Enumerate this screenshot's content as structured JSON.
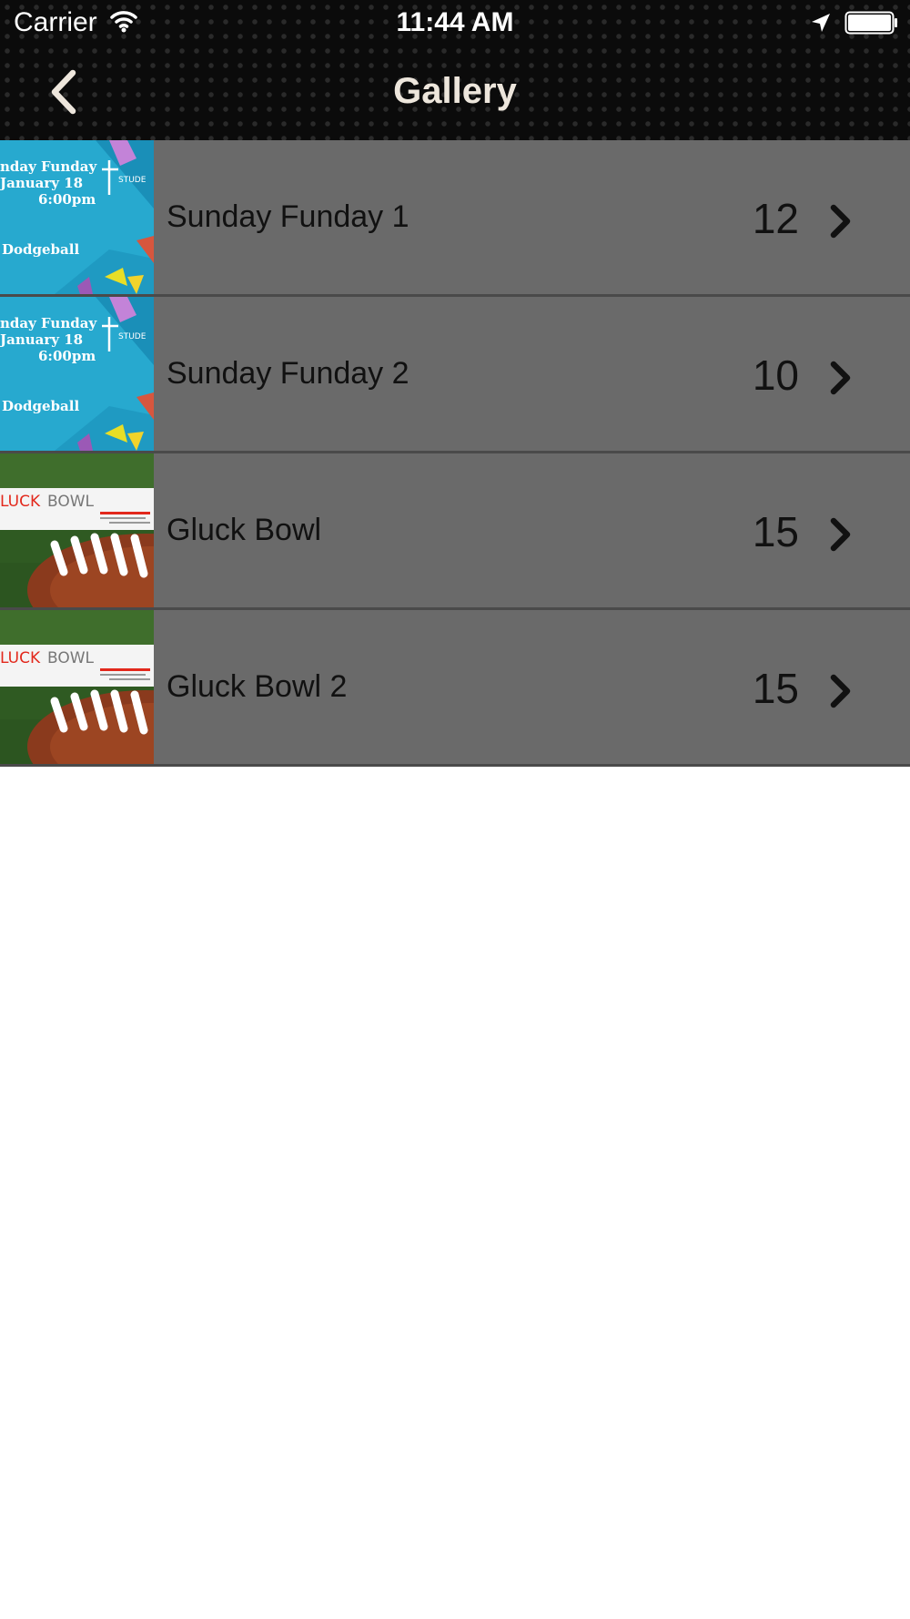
{
  "status_bar": {
    "carrier": "Carrier",
    "time": "11:44 AM"
  },
  "nav": {
    "title": "Gallery",
    "back_icon": "chevron-left-icon"
  },
  "theme": {
    "header_bg": "#0b0b0b",
    "row_bg": "#6a6a6a",
    "title_color": "#ede6dc"
  },
  "albums": [
    {
      "name": "Sunday Funday 1",
      "count": "12",
      "thumb": {
        "kind": "flyer",
        "lines": [
          "nday Funday",
          "January 18",
          "6:00pm",
          "Dodgeball"
        ],
        "badge": "STUDE"
      }
    },
    {
      "name": "Sunday Funday 2",
      "count": "10",
      "thumb": {
        "kind": "flyer",
        "lines": [
          "nday Funday",
          "January 18",
          "6:00pm",
          "Dodgeball"
        ],
        "badge": "STUDE"
      }
    },
    {
      "name": "Gluck Bowl",
      "count": "15",
      "thumb": {
        "kind": "football",
        "brand_red": "LUCK",
        "brand_gray": "BOWL"
      }
    },
    {
      "name": "Gluck Bowl 2",
      "count": "15",
      "thumb": {
        "kind": "football",
        "brand_red": "LUCK",
        "brand_gray": "BOWL"
      }
    }
  ]
}
